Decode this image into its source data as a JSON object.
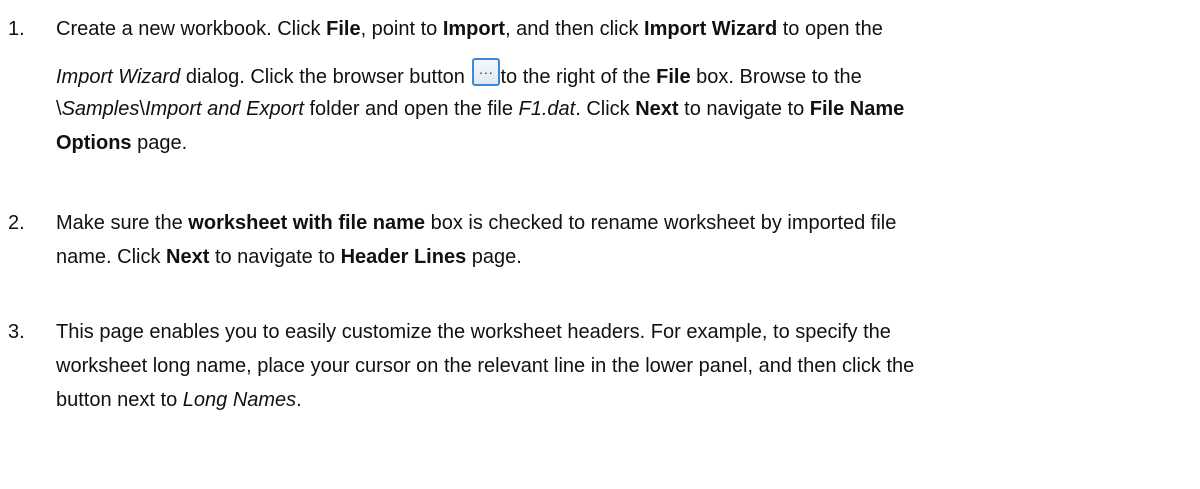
{
  "steps": [
    {
      "number": "1.",
      "line1": {
        "t1": "Create a new workbook. Click ",
        "b1": "File",
        "t2": ", point to ",
        "b2": "Import",
        "t3": ", and then click ",
        "b3": "Import Wizard",
        "t4": " to open the"
      },
      "line2": {
        "i1": "Import Wizard",
        "t1": " dialog. Click the browser button ",
        "button_glyph": "...",
        "t2": "to the right of the ",
        "b1": "File",
        "t3": " box. Browse to the"
      },
      "line3": {
        "t1": "\\",
        "i1": "Samples",
        "t2": "\\",
        "i2": "Import and Export",
        "t3": " folder and open the file ",
        "i3": "F1.dat",
        "t4": ". Click ",
        "b1": "Next",
        "t5": " to navigate to ",
        "b2": "File Name"
      },
      "line4": {
        "b1": "Options",
        "t1": " page."
      }
    },
    {
      "number": "2.",
      "line1": {
        "t1": "Make sure the ",
        "b1": "worksheet with file name",
        "t2": " box is checked to rename worksheet by imported file"
      },
      "line2": {
        "t1": "name. Click ",
        "b1": "Next",
        "t2": " to navigate to ",
        "b2": "Header Lines",
        "t3": " page."
      }
    },
    {
      "number": "3.",
      "line1": {
        "t1": "This page enables you to easily customize the worksheet headers. For example, to specify the"
      },
      "line2": {
        "t1": "worksheet long name, place your cursor on the relevant line in the lower panel, and then click the"
      },
      "line3": {
        "t1": "button next to ",
        "i1": "Long Names",
        "t2": "."
      }
    }
  ]
}
